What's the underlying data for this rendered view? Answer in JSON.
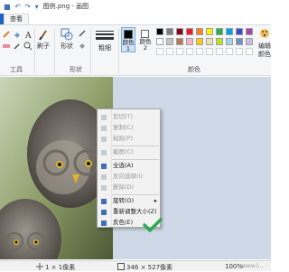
{
  "window": {
    "title": "图例.png - 画图"
  },
  "menu": {
    "tabs": [
      "查看"
    ]
  },
  "ribbon": {
    "groups": [
      "工具",
      "形状",
      "颜色"
    ],
    "brush_label": "刷子",
    "shape_label": "形状",
    "size_label": "粗细",
    "color1_label": "颜色 1",
    "color2_label": "颜色 2",
    "edit_colors_label": "编辑颜色",
    "palette": [
      "#000000",
      "#7f7f7f",
      "#880015",
      "#ed1c24",
      "#ff7f27",
      "#fff200",
      "#22b14c",
      "#00a2e8",
      "#3f48cc",
      "#a349a4",
      "#ffffff",
      "#c3c3c3",
      "#b97a57",
      "#ffaec9",
      "#ffc90e",
      "#efe4b0",
      "#b5e61d",
      "#99d9ea",
      "#7092be",
      "#c8bfe7"
    ]
  },
  "context_menu": {
    "items": [
      {
        "label": "剪切(T)",
        "enabled": false,
        "icon": "scissors-icon"
      },
      {
        "label": "复制(C)",
        "enabled": false,
        "icon": "copy-icon"
      },
      {
        "label": "粘贴(P)",
        "enabled": false,
        "icon": "paste-icon"
      },
      {
        "label": "截图(C)",
        "enabled": false,
        "icon": "crop-icon"
      },
      {
        "label": "全选(A)",
        "enabled": true,
        "icon": "select-all-icon"
      },
      {
        "label": "反向选择(I)",
        "enabled": false,
        "icon": "invert-selection-icon"
      },
      {
        "label": "删除(D)",
        "enabled": false,
        "icon": "delete-icon"
      },
      {
        "label": "旋转(O)",
        "enabled": true,
        "icon": "rotate-icon",
        "submenu": true
      },
      {
        "label": "重新调整大小(Z)",
        "enabled": true,
        "icon": "resize-icon"
      },
      {
        "label": "反色(E)",
        "enabled": true,
        "icon": "invert-color-icon"
      }
    ]
  },
  "status": {
    "position": "1 × 1像素",
    "image_size": "346 × 527像素",
    "zoom": "100%",
    "watermark": "www.l..."
  }
}
